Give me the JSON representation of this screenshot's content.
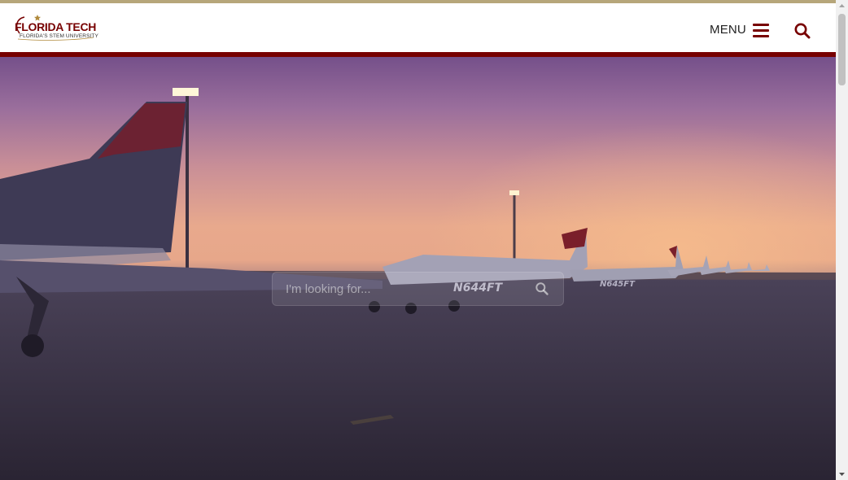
{
  "header": {
    "logo_title": "FLORIDA TECH",
    "logo_tagline": "FLORIDA'S STEM UNIVERSITY",
    "menu_label": "MENU"
  },
  "hero": {
    "search_placeholder": "I'm looking for...",
    "plane_tail_number": "N644FT",
    "plane2_tail_number": "N645FT"
  },
  "icons": {
    "hamburger": "hamburger-icon",
    "search": "search-icon",
    "hero_search": "search-icon"
  },
  "colors": {
    "brand_maroon": "#770000",
    "gold_strip": "#b6a67a",
    "header_bg": "#ffffff"
  }
}
